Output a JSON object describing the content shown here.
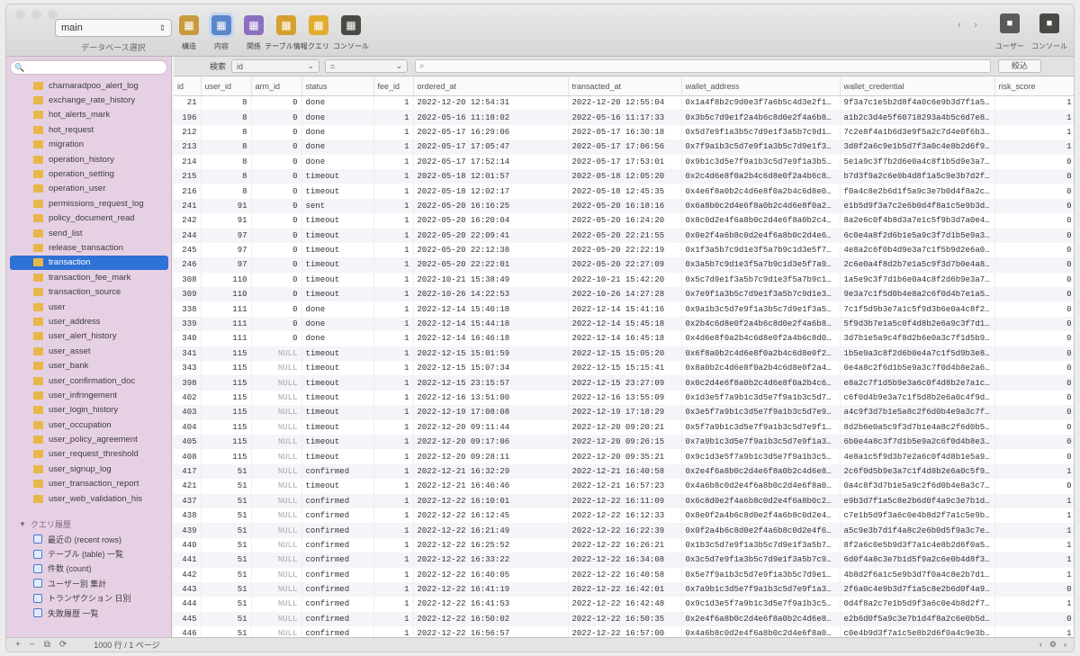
{
  "toolbar": {
    "database": "main",
    "database_caption": "データベース選択",
    "tools": [
      {
        "label": "構造",
        "icon": "structure-icon",
        "color": "#c79a3b"
      },
      {
        "label": "内容",
        "icon": "content-icon",
        "color": "#5b86c9",
        "active": true
      },
      {
        "label": "関係",
        "icon": "relations-icon",
        "color": "#8c6fc1"
      },
      {
        "label": "テーブル情報",
        "icon": "table-info-icon",
        "color": "#d4a12e"
      },
      {
        "label": "クエリ",
        "icon": "query-icon",
        "color": "#e0ad2f"
      },
      {
        "label": "コンソール",
        "icon": "console-icon",
        "color": "#4a4a44"
      }
    ],
    "right_tools": [
      {
        "label": "ユーザー",
        "icon": "user-icon",
        "color": "#5a5a5a"
      },
      {
        "label": "コンソール",
        "icon": "terminal-icon",
        "color": "#4a4a44"
      }
    ]
  },
  "sidebar": {
    "search_placeholder": "",
    "tables": [
      "chamaradpoo_alert_log",
      "exchange_rate_history",
      "hot_alerts_mark",
      "hot_request",
      "migration",
      "operation_history",
      "operation_setting",
      "operation_user",
      "permissions_request_log",
      "policy_document_read",
      "send_list",
      "release_transaction",
      "transaction",
      "transaction_fee_mark",
      "transaction_source",
      "user",
      "user_address",
      "user_alert_history",
      "user_asset",
      "user_bank",
      "user_confirmation_doc",
      "user_infringement",
      "user_login_history",
      "user_occupation",
      "user_policy_agreement",
      "user_request_threshold",
      "user_signup_log",
      "user_transaction_report",
      "user_web_validation_his"
    ],
    "selected_table": "transaction",
    "queries_header": "クエリ履歴",
    "queries": [
      "最近の (recent rows)",
      "テーブル (table) 一覧",
      "件数 (count)",
      "ユーザー別 集計",
      "トランザクション 日別",
      "失敗履歴 一覧"
    ]
  },
  "filter": {
    "label": "検索",
    "column_select": "id",
    "operator_select": "=",
    "search_value": "",
    "button": "絞込"
  },
  "grid": {
    "columns": [
      "id",
      "user_id",
      "arm_id",
      "status",
      "fee_id",
      "ordered_at",
      "transacted_at",
      "wallet_address",
      "wallet_credential",
      "risk_score"
    ],
    "rows": [
      [
        "21",
        "8",
        "0",
        "done",
        "1",
        "2022-12-20 12:54:31",
        "2022-12-20 12:55:04",
        "0x1a4f8b2c9d0e3f7a6b5c4d3e2f1a0b9c8d7e6f5",
        "9f3a7c1e5b2d8f4a0c6e9b3d7f1a5c8e2b6d4f0a7",
        "1"
      ],
      [
        "196",
        "8",
        "0",
        "done",
        "1",
        "2022-05-16 11:18:02",
        "2022-05-16 11:17:33",
        "0x3b5c7d9e1f2a4b6c8d0e2f4a6b8c0d2e4f6a8b0",
        "a1b2c3d4e5f60718293a4b5c6d7e8f90a1b2c3d4",
        "1"
      ],
      [
        "212",
        "8",
        "0",
        "done",
        "1",
        "2022-05-17 16:29:06",
        "2022-05-17 16:30:18",
        "0x5d7e9f1a3b5c7d9e1f3a5b7c9d1e3f5a7b9c1d3",
        "7c2e8f4a1b6d3e9f5a2c7d4e0f6b3a8c5e1d7f2b",
        "1"
      ],
      [
        "213",
        "8",
        "0",
        "done",
        "1",
        "2022-05-17 17:05:47",
        "2022-05-17 17:06:56",
        "0x7f9a1b3c5d7e9f1a3b5c7d9e1f3a5b7c9d1e3f5",
        "3d8f2a6c9e1b5d7f3a0c4e8b2d6f9a1c5e7b3d0f",
        "1"
      ],
      [
        "214",
        "8",
        "0",
        "done",
        "1",
        "2022-05-17 17:52:14",
        "2022-05-17 17:53:01",
        "0x9b1c3d5e7f9a1b3c5d7e9f1a3b5c7d9e1f3a5b7",
        "5e1a9c3f7b2d6e0a4c8f1b5d9e3a7c2f6b0d4e8a",
        "0"
      ],
      [
        "215",
        "8",
        "0",
        "timeout",
        "1",
        "2022-05-18 12:01:57",
        "2022-05-18 12:05:20",
        "0x2c4d6e8f0a2b4c6d8e0f2a4b6c8d0e2f4a6b8c0",
        "b7d3f9a2c6e0b4d8f1a5c9e3b7d2f6a0c4e8b1d5",
        "0"
      ],
      [
        "216",
        "8",
        "0",
        "timeout",
        "1",
        "2022-05-18 12:02:17",
        "2022-05-18 12:45:35",
        "0x4e6f8a0b2c4d6e8f0a2b4c6d8e0f2a4b6c8d0e2",
        "f0a4c8e2b6d1f5a9c3e7b0d4f8a2c6e1b5d9f3a7",
        "0"
      ],
      [
        "241",
        "91",
        "0",
        "sent",
        "1",
        "2022-05-20 16:16:25",
        "2022-05-20 16:18:16",
        "0x6a8b0c2d4e6f8a0b2c4d6e8f0a2b4c6d8e0f2a4",
        "e1b5d9f3a7c2e6b0d4f8a1c5e9b3d7f2a6c0e4b8",
        "0"
      ],
      [
        "242",
        "91",
        "0",
        "timeout",
        "1",
        "2022-05-20 16:20:04",
        "2022-05-20 16:24:20",
        "0x8c0d2e4f6a8b0c2d4e6f8a0b2c4d6e8f0a2b4c6",
        "8a2e6c0f4b8d3a7e1c5f9b3d7a0e4c8f2b6d1a5e",
        "0"
      ],
      [
        "244",
        "97",
        "0",
        "timeout",
        "1",
        "2022-05-20 22:09:41",
        "2022-05-20 22:21:55",
        "0x0e2f4a6b8c0d2e4f6a8b0c2d4e6f8a0b2c4d6e8",
        "6c0e4a8f2d6b1e5a9c3f7d1b5e9a3c7f0d4b8e2a",
        "0"
      ],
      [
        "245",
        "97",
        "0",
        "timeout",
        "1",
        "2022-05-20 22:12:38",
        "2022-05-20 22:22:19",
        "0x1f3a5b7c9d1e3f5a7b9c1d3e5f7a9b1c3d5e7f9",
        "4e8a2c6f0b4d9e3a7c1f5b9d2e6a0c4f8b3d7e1a",
        "0"
      ],
      [
        "246",
        "97",
        "0",
        "timeout",
        "1",
        "2022-05-20 22:22:01",
        "2022-05-20 22:27:09",
        "0x3a5b7c9d1e3f5a7b9c1d3e5f7a9b1c3d5e7f9a1",
        "2c6e0a4f8d2b7e1a5c9f3d7b0e4a8c2f6d1b5e9a",
        "0"
      ],
      [
        "308",
        "110",
        "0",
        "timeout",
        "1",
        "2022-10-21 15:38:49",
        "2022-10-21 15:42:20",
        "0x5c7d9e1f3a5b7c9d1e3f5a7b9c1d3e5f7a9b1c3",
        "1a5e9c3f7d1b6e0a4c8f2d6b9e3a7c1f5d0b4e8a",
        "0"
      ],
      [
        "309",
        "110",
        "0",
        "timeout",
        "1",
        "2022-10-26 14:22:53",
        "2022-10-26 14:27:28",
        "0x7e9f1a3b5c7d9e1f3a5b7c9d1e3f5a7b9c1d3e5",
        "9e3a7c1f5d0b4e8a2c6f0d4b7e1a5c9f3d8b2e6a",
        "0"
      ],
      [
        "338",
        "111",
        "0",
        "done",
        "1",
        "2022-12-14 15:40:18",
        "2022-12-14 15:41:16",
        "0x9a1b3c5d7e9f1a3b5c7d9e1f3a5b7c9d1e3f5a7",
        "7c1f5d9b3e7a1c5f9d3b6e0a4c8f2d7b1e5a9c3f",
        "0"
      ],
      [
        "339",
        "111",
        "0",
        "done",
        "1",
        "2022-12-14 15:44:18",
        "2022-12-14 15:45:18",
        "0x2b4c6d8e0f2a4b6c8d0e2f4a6b8c0d2e4f6a8b0",
        "5f9d3b7e1a5c0f4d8b2e6a9c3f7d1b5e0a4c8f2d",
        "0"
      ],
      [
        "340",
        "111",
        "0",
        "done",
        "1",
        "2022-12-14 16:46:18",
        "2022-12-14 16:45:18",
        "0x4d6e8f0a2b4c6d8e0f2a4b6c8d0e2f4a6b8c0d2",
        "3d7b1e5a9c4f8d2b6e0a3c7f1d5b9e4a8c2f6d0b",
        "0"
      ],
      [
        "341",
        "115",
        "NULL",
        "timeout",
        "1",
        "2022-12-15 15:01:59",
        "2022-12-15 15:05:20",
        "0x6f8a0b2c4d6e8f0a2b4c6d8e0f2a4b6c8d0e2f4",
        "1b5e9a3c8f2d6b0e4a7c1f5d9b3e8a2c6f0d4b7e",
        "0"
      ],
      [
        "343",
        "115",
        "NULL",
        "timeout",
        "1",
        "2022-12-15 15:07:34",
        "2022-12-15 15:15:41",
        "0x8a0b2c4d6e8f0a2b4c6d8e0f2a4b6c8d0e2f4a6",
        "0e4a8c2f6d1b5e9a3c7f0d4b8e2a6c1f5d9b3e7a",
        "0"
      ],
      [
        "398",
        "115",
        "NULL",
        "timeout",
        "1",
        "2022-12-15 23:15:57",
        "2022-12-15 23:27:09",
        "0x0c2d4e6f8a0b2c4d6e8f0a2b4c6d8e0f2a4b6c8",
        "e8a2c7f1d5b9e3a6c0f4d8b2e7a1c5f9d3b6e0a4",
        "0"
      ],
      [
        "402",
        "115",
        "NULL",
        "timeout",
        "1",
        "2022-12-16 13:51:00",
        "2022-12-16 13:55:09",
        "0x1d3e5f7a9b1c3d5e7f9a1b3c5d7e9f1a3b5c7d9",
        "c6f0d4b9e3a7c1f5d8b2e6a0c4f9d3b7e1a5c8f2",
        "0"
      ],
      [
        "403",
        "115",
        "NULL",
        "timeout",
        "1",
        "2022-12-19 17:08:08",
        "2022-12-19 17:18:29",
        "0x3e5f7a9b1c3d5e7f9a1b3c5d7e9f1a3b5c7d9e1",
        "a4c9f3d7b1e5a8c2f6d0b4e9a3c7f1d6b0e4a8c2",
        "0"
      ],
      [
        "404",
        "115",
        "NULL",
        "timeout",
        "1",
        "2022-12-20 09:11:44",
        "2022-12-20 09:20:21",
        "0x5f7a9b1c3d5e7f9a1b3c5d7e9f1a3b5c7d9e1f3",
        "8d2b6e0a5c9f3d7b1e4a8c2f6d0b5e9a3c7f1d4b",
        "0"
      ],
      [
        "405",
        "115",
        "NULL",
        "timeout",
        "1",
        "2022-12-20 09:17:06",
        "2022-12-20 09:26:15",
        "0x7a9b1c3d5e7f9a1b3c5d7e9f1a3b5c7d9e1f3a5",
        "6b0e4a8c3f7d1b5e9a2c6f0d4b8e3a7c1f5d9b2e",
        "0"
      ],
      [
        "408",
        "115",
        "NULL",
        "timeout",
        "1",
        "2022-12-20 09:28:11",
        "2022-12-20 09:35:21",
        "0x9c1d3e5f7a9b1c3d5e7f9a1b3c5d7e9f1a3b5c7",
        "4e8a1c5f9d3b7e2a6c0f4d8b1e5a9c3f7d2b6e0a",
        "0"
      ],
      [
        "417",
        "51",
        "NULL",
        "confirmed",
        "1",
        "2022-12-21 16:32:29",
        "2022-12-21 16:40:58",
        "0x2e4f6a8b0c2d4e6f8a0b2c4d6e8f0a2b4c6d8e0",
        "2c6f0d5b9e3a7c1f4d8b2e6a0c5f9d3b7e1a4c8f",
        "1"
      ],
      [
        "421",
        "51",
        "NULL",
        "timeout",
        "1",
        "2022-12-21 16:46:46",
        "2022-12-21 16:57:23",
        "0x4a6b8c0d2e4f6a8b0c2d4e6f8a0b2c4d6e8f0a2",
        "0a4c8f3d7b1e5a9c2f6d0b4e8a3c7f1d5b9e2a6c",
        "0"
      ],
      [
        "437",
        "51",
        "NULL",
        "confirmed",
        "1",
        "2022-12-22 16:10:01",
        "2022-12-22 16:11:09",
        "0x6c8d0e2f4a6b8c0d2e4f6a8b0c2d4e6f8a0b2c4",
        "e9b3d7f1a5c8e2b6d0f4a9c3e7b1d5f8a2c6e0b4",
        "1"
      ],
      [
        "438",
        "51",
        "NULL",
        "confirmed",
        "1",
        "2022-12-22 16:12:45",
        "2022-12-22 16:12:33",
        "0x8e0f2a4b6c8d0e2f4a6b8c0d2e4f6a8b0c2d4e6",
        "c7e1b5d9f3a6c0e4b8d2f7a1c5e9b3d6f0a4c8e2",
        "1"
      ],
      [
        "439",
        "51",
        "NULL",
        "confirmed",
        "1",
        "2022-12-22 16:21:49",
        "2022-12-22 16:22:39",
        "0x0f2a4b6c8d0e2f4a6b8c0d2e4f6a8b0c2d4e6f8",
        "a5c9e3b7d1f4a8c2e6b0d5f9a3c7e1b4d8f2a6c0",
        "1"
      ],
      [
        "440",
        "51",
        "NULL",
        "confirmed",
        "1",
        "2022-12-22 16:25:52",
        "2022-12-22 16:26:21",
        "0x1b3c5d7e9f1a3b5c7d9e1f3a5b7c9d1e3f5a7b9",
        "8f2a6c0e5b9d3f7a1c4e8b2d6f0a5c9e3b7d1f4a",
        "1"
      ],
      [
        "441",
        "51",
        "NULL",
        "confirmed",
        "1",
        "2022-12-22 16:33:22",
        "2022-12-22 16:34:08",
        "0x3c5d7e9f1a3b5c7d9e1f3a5b7c9d1e3f5a7b9c1",
        "6d0f4a8c3e7b1d5f9a2c6e0b4d8f3a7c1e5b9d2f",
        "1"
      ],
      [
        "442",
        "51",
        "NULL",
        "confirmed",
        "1",
        "2022-12-22 16:40:05",
        "2022-12-22 16:40:58",
        "0x5e7f9a1b3c5d7e9f1a3b5c7d9e1f3a5b7c9d1e3",
        "4b8d2f6a1c5e9b3d7f0a4c8e2b7d1f5a9c3e6b0d",
        "1"
      ],
      [
        "443",
        "51",
        "NULL",
        "confirmed",
        "1",
        "2022-12-22 16:41:19",
        "2022-12-22 16:42:01",
        "0x7a9b1c3d5e7f9a1b3c5d7e9f1a3b5c7d9e1f3a5",
        "2f6a0c4e9b3d7f1a5c8e2b6d0f4a9c3e7b1d5f8a",
        "0"
      ],
      [
        "444",
        "51",
        "NULL",
        "confirmed",
        "1",
        "2022-12-22 16:41:53",
        "2022-12-22 16:42:48",
        "0x9c1d3e5f7a9b1c3d5e7f9a1b3c5d7e9f1a3b5c7",
        "0d4f8a2c7e1b5d9f3a6c0e4b8d2f7a1c5e9b3d6f",
        "1"
      ],
      [
        "445",
        "51",
        "NULL",
        "confirmed",
        "1",
        "2022-12-22 16:50:02",
        "2022-12-22 16:50:35",
        "0x2e4f6a8b0c2d4e6f8a0b2c4d6e8f0a2b4c6d8e0",
        "e2b6d0f5a9c3e7b1d4f8a2c6e0b5d9f3a7c1e4b8",
        "0"
      ],
      [
        "446",
        "51",
        "NULL",
        "confirmed",
        "1",
        "2022-12-22 16:56:57",
        "2022-12-22 16:57:00",
        "0x4a6b8c0d2e4f6a8b0c2d4e6f8a0b2c4d6e8f0a2",
        "c0e4b9d3f7a1c5e8b2d6f0a4c9e3b7d1f5a8c2e6",
        "1"
      ],
      [
        "447",
        "51",
        "NULL",
        "done",
        "1",
        "2022-12-22 16:57:43",
        "2022-12-22 16:58:16",
        "0x6c8d0e2f4a6b8c0d2e4f6a8b0c2d4e6f8a0b2c4",
        "a8c2e7b1d5f9a3c6e0b4d8f2a7c1e5b9d3f6a0c4",
        "1"
      ]
    ]
  },
  "bottom": {
    "rows_text": "1000 行 / 1 ページ"
  }
}
